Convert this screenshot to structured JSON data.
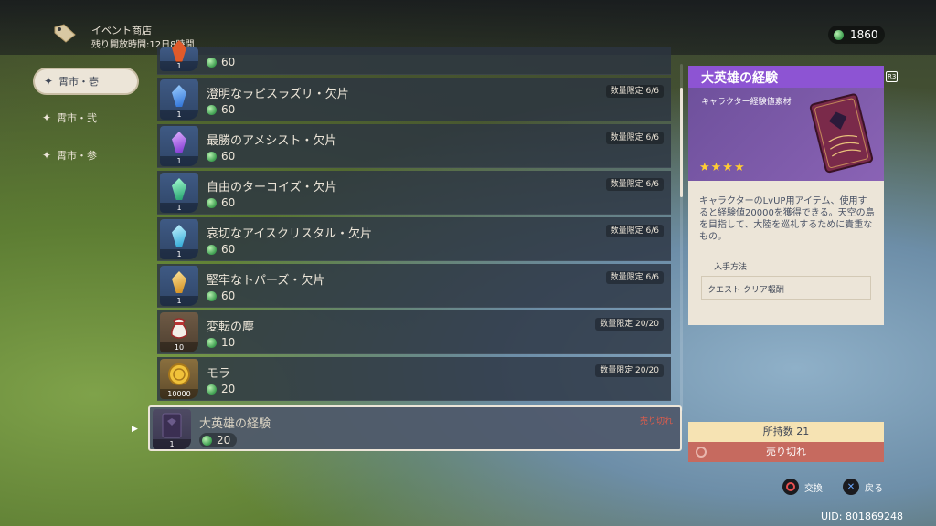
{
  "header": {
    "title": "イベント商店",
    "time_left": "残り開放時間:12日8時間"
  },
  "currency": {
    "amount": "1860",
    "icon": "primogem-green-coin"
  },
  "tabs": [
    {
      "label": "霄市・壱",
      "active": true
    },
    {
      "label": "霄市・弐",
      "active": false
    },
    {
      "label": "霄市・参",
      "active": false
    }
  ],
  "items": [
    {
      "name": "",
      "price": "60",
      "qty": "1",
      "limit": "",
      "icon": "gem-orange"
    },
    {
      "name": "澄明なラピスラズリ・欠片",
      "price": "60",
      "qty": "1",
      "limit": "数量限定 6/6",
      "icon": "gem-blue"
    },
    {
      "name": "最勝のアメシスト・欠片",
      "price": "60",
      "qty": "1",
      "limit": "数量限定 6/6",
      "icon": "gem-purple"
    },
    {
      "name": "自由のターコイズ・欠片",
      "price": "60",
      "qty": "1",
      "limit": "数量限定 6/6",
      "icon": "gem-teal"
    },
    {
      "name": "哀切なアイスクリスタル・欠片",
      "price": "60",
      "qty": "1",
      "limit": "数量限定 6/6",
      "icon": "gem-cyan"
    },
    {
      "name": "堅牢なトパーズ・欠片",
      "price": "60",
      "qty": "1",
      "limit": "数量限定 6/6",
      "icon": "gem-gold"
    },
    {
      "name": "変転の塵",
      "price": "10",
      "qty": "10",
      "limit": "数量限定 20/20",
      "icon": "dust-bag"
    },
    {
      "name": "モラ",
      "price": "20",
      "qty": "10000",
      "limit": "数量限定 20/20",
      "icon": "mora-coin"
    },
    {
      "name": "大英雄の経験",
      "price": "20",
      "qty": "1",
      "limit": "売り切れ",
      "icon": "exp-book"
    }
  ],
  "detail": {
    "title": "大英雄の経験",
    "category": "キャラクター経験値素材",
    "rarity_stars": "★★★★",
    "description": "キャラクターのLvUP用アイテム、使用すると経験値20000を獲得できる。天空の島を目指して、大陸を巡礼するために貴重なもの。",
    "source_label": "入手方法",
    "source_value": "クエスト クリア報酬",
    "r3": "R3"
  },
  "footer": {
    "owned": "所持数 21",
    "sold_out": "売り切れ",
    "exchange": "交換",
    "back": "戻る",
    "uid": "UID: 801869248"
  }
}
